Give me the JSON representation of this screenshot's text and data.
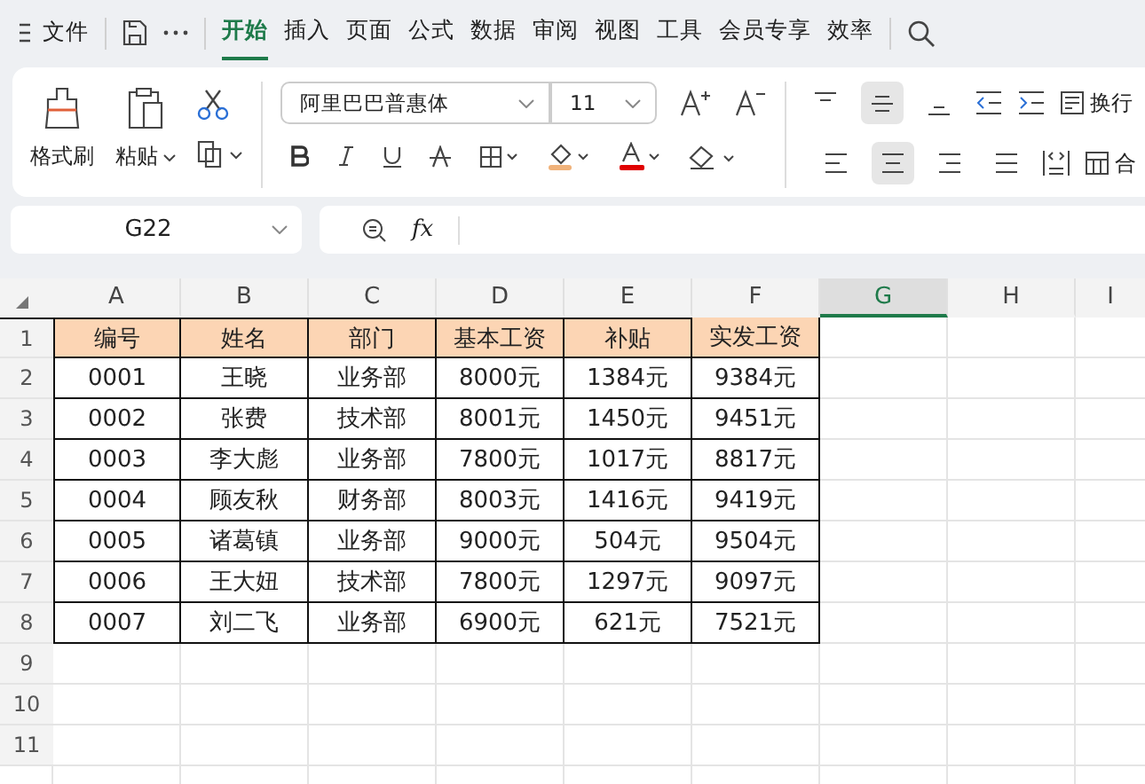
{
  "menu_bar": {
    "file_label": "文件",
    "tabs": [
      {
        "label": "开始",
        "selected": true
      },
      {
        "label": "插入",
        "selected": false
      },
      {
        "label": "页面",
        "selected": false
      },
      {
        "label": "公式",
        "selected": false
      },
      {
        "label": "数据",
        "selected": false
      },
      {
        "label": "审阅",
        "selected": false
      },
      {
        "label": "视图",
        "selected": false
      },
      {
        "label": "工具",
        "selected": false
      },
      {
        "label": "会员专享",
        "selected": false
      },
      {
        "label": "效率",
        "selected": false
      }
    ]
  },
  "ribbon": {
    "format_painter": "格式刷",
    "paste": "粘贴",
    "font_name": "阿里巴巴普惠体",
    "font_size": "11",
    "vertical_align": [
      {
        "kind": "top",
        "selected": false
      },
      {
        "kind": "middle",
        "selected": true
      },
      {
        "kind": "bottom",
        "selected": false
      }
    ],
    "horizontal_align": [
      {
        "kind": "left",
        "selected": false
      },
      {
        "kind": "center",
        "selected": true
      },
      {
        "kind": "right",
        "selected": false
      },
      {
        "kind": "justify",
        "selected": false
      }
    ],
    "wrap_label": "换行",
    "merge_label": "合"
  },
  "formula_bar": {
    "name_box": "G22",
    "function_label": "fx"
  },
  "sheet": {
    "columns": [
      {
        "label": "A",
        "selected": false
      },
      {
        "label": "B",
        "selected": false
      },
      {
        "label": "C",
        "selected": false
      },
      {
        "label": "D",
        "selected": false
      },
      {
        "label": "E",
        "selected": false
      },
      {
        "label": "F",
        "selected": false
      },
      {
        "label": "G",
        "selected": true
      },
      {
        "label": "H",
        "selected": false
      },
      {
        "label": "I",
        "selected": false
      }
    ],
    "row_numbers": [
      "1",
      "2",
      "3",
      "4",
      "5",
      "6",
      "7",
      "8",
      "9",
      "10",
      "11"
    ],
    "table": {
      "columns": [
        "编号",
        "姓名",
        "部门",
        "基本工资",
        "补贴",
        "实发工资"
      ],
      "rows": [
        [
          "0001",
          "王晓",
          "业务部",
          "8000元",
          "1384元",
          "9384元"
        ],
        [
          "0002",
          "张费",
          "技术部",
          "8001元",
          "1450元",
          "9451元"
        ],
        [
          "0003",
          "李大彪",
          "业务部",
          "7800元",
          "1017元",
          "8817元"
        ],
        [
          "0004",
          "顾友秋",
          "财务部",
          "8003元",
          "1416元",
          "9419元"
        ],
        [
          "0005",
          "诸葛镇",
          "业务部",
          "9000元",
          "504元",
          "9504元"
        ],
        [
          "0006",
          "王大妞",
          "技术部",
          "7800元",
          "1297元",
          "9097元"
        ],
        [
          "0007",
          "刘二飞",
          "业务部",
          "6900元",
          "621元",
          "7521元"
        ]
      ]
    }
  }
}
